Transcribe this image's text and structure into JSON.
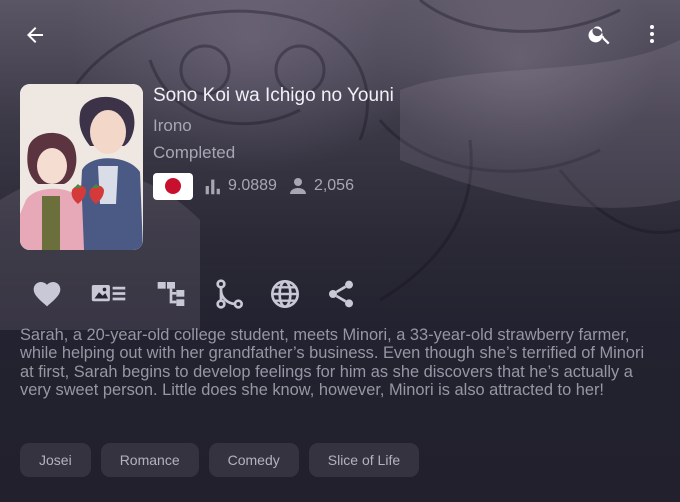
{
  "header": {
    "back_icon": "arrow-left-icon",
    "search_icon": "search-icon",
    "more_icon": "more-vertical-icon"
  },
  "manga": {
    "title": "Sono Koi wa Ichigo no Youni",
    "author": "Irono",
    "status": "Completed",
    "country_flag_icon": "japan-flag-icon",
    "rating": "9.0889",
    "followers": "2,056",
    "rating_icon": "bar-chart-icon",
    "followers_icon": "person-icon"
  },
  "actions": [
    {
      "icon": "heart-icon"
    },
    {
      "icon": "image-list-icon"
    },
    {
      "icon": "hierarchy-icon"
    },
    {
      "icon": "branch-icon"
    },
    {
      "icon": "globe-icon"
    },
    {
      "icon": "share-icon"
    }
  ],
  "summary": "Sarah, a 20-year-old college student, meets Minori, a 33-year-old strawberry farmer, while helping out with her grandfather’s business. Even though she’s terrified of Minori at first, Sarah begins to develop feelings for him as she discovers that he’s actually a very sweet person. Little does she know, however, Minori is also attracted to her!",
  "tags": [
    "Josei",
    "Romance",
    "Comedy",
    "Slice of Life"
  ],
  "colors": {
    "background": "#24232f",
    "tag_background": "#34333f",
    "icon": "#c9c8d6",
    "flag_red": "#c8102e"
  }
}
